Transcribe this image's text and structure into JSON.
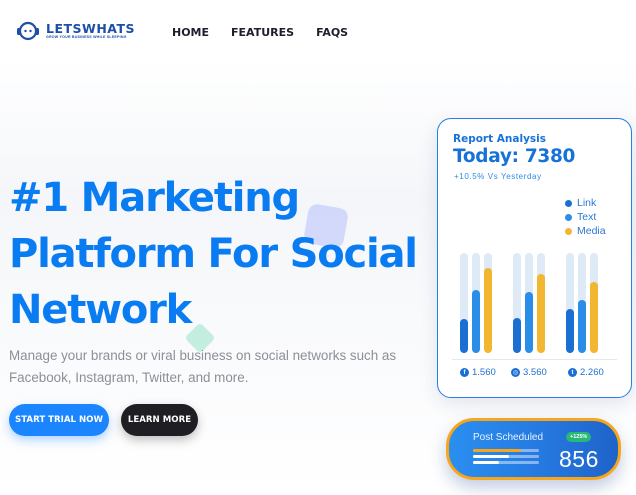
{
  "header": {
    "logo": {
      "name": "LETSWHATS",
      "tagline": "GROW YOUR BUSINESS WHILE SLEEPING",
      "icon": "headset-logo-icon"
    },
    "nav": [
      {
        "label": "HOME"
      },
      {
        "label": "FEATURES"
      },
      {
        "label": "FAQS"
      }
    ]
  },
  "hero": {
    "title": "#1 Marketing Platform For Social Network",
    "subtitle": "Manage your brands or viral business on social networks such as Facebook, Instagram, Twitter, and more.",
    "primary_button": "START TRIAL NOW",
    "secondary_button": "LEARN MORE"
  },
  "report": {
    "title": "Report Analysis",
    "today": "Today: 7380",
    "delta": "+10.5% Vs Yesterday",
    "legend": [
      {
        "label": "Link",
        "color": "#1a6fd3"
      },
      {
        "label": "Text",
        "color": "#2a8de8"
      },
      {
        "label": "Media",
        "color": "#f2b630"
      }
    ],
    "stats": [
      {
        "icon": "facebook-icon",
        "glyph": "f",
        "value": "1.560"
      },
      {
        "icon": "instagram-icon",
        "glyph": "◎",
        "value": "3.560"
      },
      {
        "icon": "twitter-icon",
        "glyph": "t",
        "value": "2.260"
      }
    ]
  },
  "chart_data": {
    "type": "bar",
    "categories": [
      "Facebook",
      "Instagram",
      "Twitter"
    ],
    "series": [
      {
        "name": "Link",
        "values": [
          0.34,
          0.35,
          0.44
        ],
        "color": "#1a6fd3"
      },
      {
        "name": "Text",
        "values": [
          0.63,
          0.61,
          0.53
        ],
        "color": "#2a8de8"
      },
      {
        "name": "Media",
        "values": [
          0.85,
          0.79,
          0.71
        ],
        "color": "#f2b630"
      }
    ],
    "track_color": "#dfeaf7",
    "ylim": [
      0,
      1
    ],
    "grid": false
  },
  "scheduled": {
    "label": "Post Scheduled",
    "badge": "+125%",
    "value": "856",
    "bars": [
      {
        "fraction": 0.72,
        "color": "#f7a61c"
      },
      {
        "fraction": 0.55,
        "color": "#ffffff"
      },
      {
        "fraction": 0.4,
        "color": "#ffffff"
      }
    ]
  }
}
